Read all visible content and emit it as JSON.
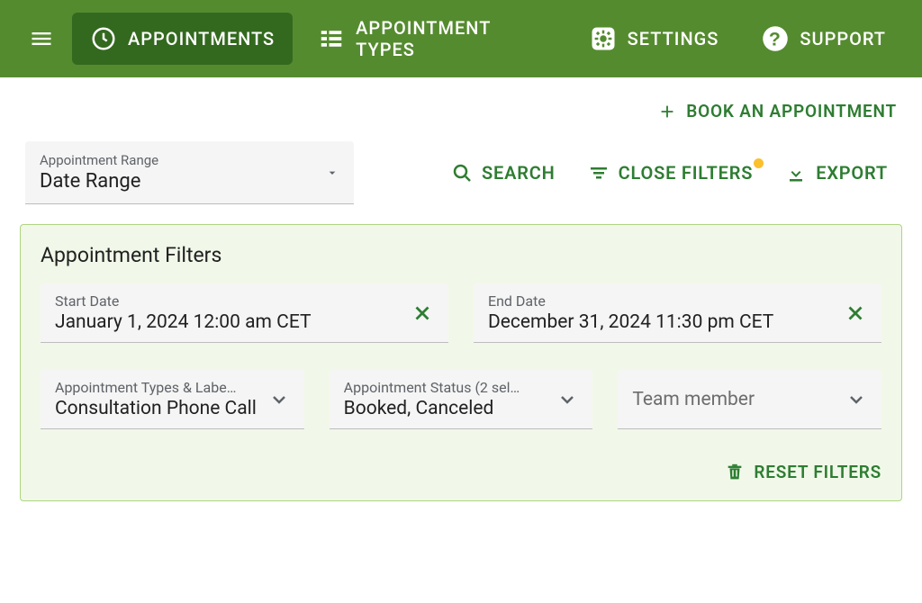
{
  "nav": {
    "appointments": "APPOINTMENTS",
    "appointment_types": "APPOINTMENT TYPES",
    "settings": "SETTINGS",
    "support": "SUPPORT"
  },
  "actions": {
    "book": "BOOK AN APPOINTMENT",
    "search": "SEARCH",
    "close_filters": "CLOSE FILTERS",
    "export": "EXPORT",
    "reset_filters": "RESET FILTERS"
  },
  "range_select": {
    "label": "Appointment Range",
    "value": "Date Range"
  },
  "filters": {
    "title": "Appointment Filters",
    "start_date": {
      "label": "Start Date",
      "value": "January 1, 2024 12:00 am CET"
    },
    "end_date": {
      "label": "End Date",
      "value": "December 31, 2024 11:30 pm CET"
    },
    "types": {
      "label": "Appointment Types & Labe…",
      "value": "Consultation Phone Call"
    },
    "status": {
      "label": "Appointment Status (2 sel…",
      "value": "Booked, Canceled"
    },
    "team": {
      "label": "",
      "value": "Team member"
    }
  }
}
